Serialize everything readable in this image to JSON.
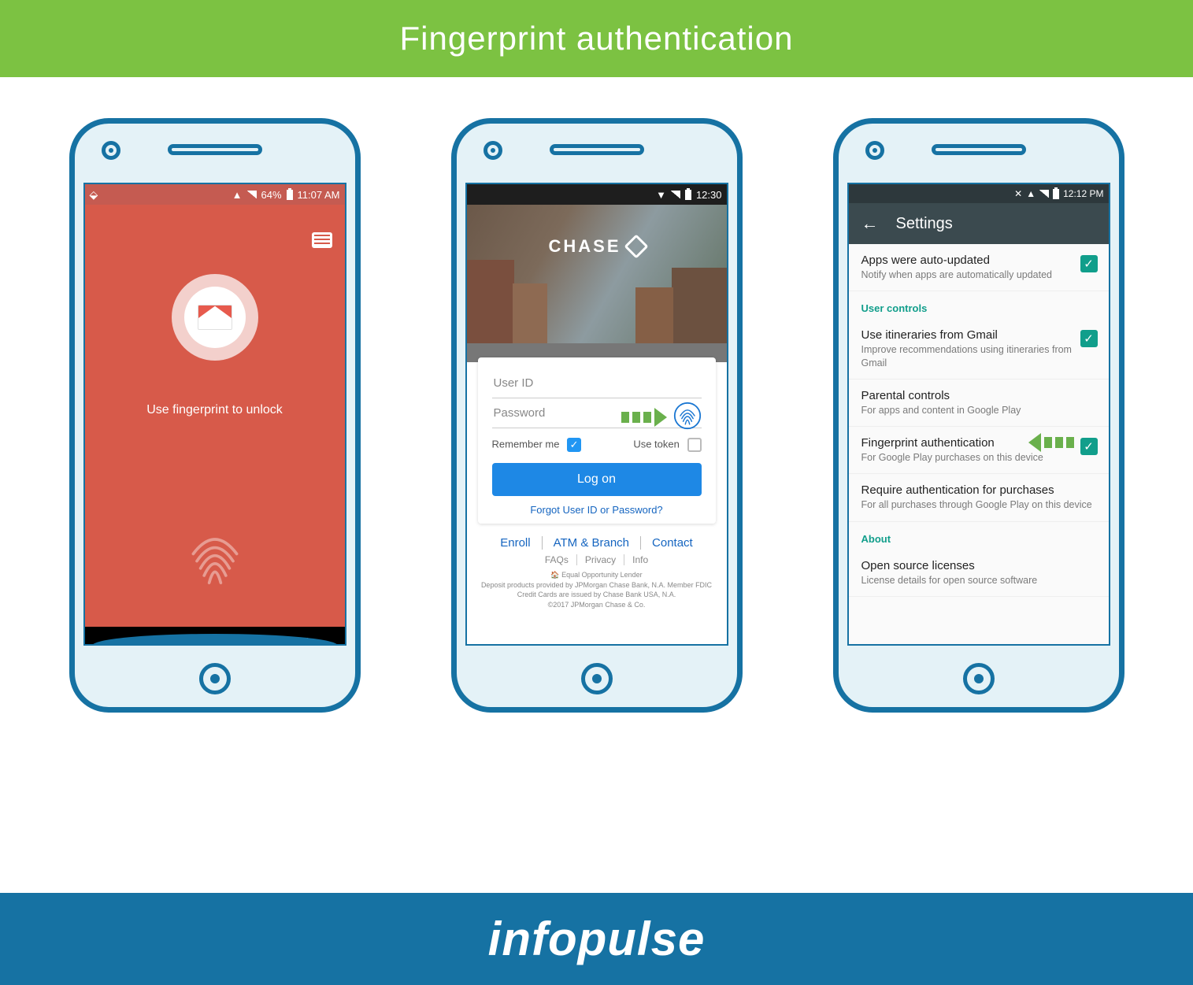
{
  "title": "Fingerprint authentication",
  "footer_brand": "infopulse",
  "phone1": {
    "status_battery": "64%",
    "status_time": "11:07 AM",
    "prompt": "Use fingerprint to unlock"
  },
  "phone2": {
    "status_time": "12:30",
    "brand": "CHASE",
    "user_id_placeholder": "User ID",
    "password_placeholder": "Password",
    "remember_label": "Remember me",
    "token_label": "Use token",
    "logon_label": "Log on",
    "forgot_label": "Forgot User ID or Password?",
    "links": {
      "enroll": "Enroll",
      "atm": "ATM & Branch",
      "contact": "Contact"
    },
    "sublinks": {
      "faqs": "FAQs",
      "privacy": "Privacy",
      "info": "Info"
    },
    "fine1": "🏠 Equal Opportunity Lender",
    "fine2": "Deposit products provided by JPMorgan Chase Bank, N.A. Member FDIC",
    "fine3": "Credit Cards are issued by Chase Bank USA, N.A.",
    "fine4": "©2017 JPMorgan Chase & Co."
  },
  "phone3": {
    "status_time": "12:12 PM",
    "appbar_title": "Settings",
    "items": [
      {
        "t": "Apps were auto-updated",
        "s": "Notify when apps are automatically updated",
        "chk": true
      },
      {
        "hdr": "User controls"
      },
      {
        "t": "Use itineraries from Gmail",
        "s": "Improve recommendations using itineraries from Gmail",
        "chk": true
      },
      {
        "t": "Parental controls",
        "s": "For apps and content in Google Play"
      },
      {
        "t": "Fingerprint authentication",
        "s": "For Google Play purchases on this device",
        "chk": true,
        "arrow": true
      },
      {
        "t": "Require authentication for purchases",
        "s": "For all purchases through Google Play on this device"
      },
      {
        "hdr": "About"
      },
      {
        "t": "Open source licenses",
        "s": "License details for open source software"
      }
    ]
  }
}
